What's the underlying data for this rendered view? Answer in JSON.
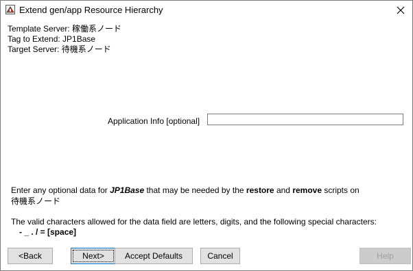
{
  "window": {
    "title": "Extend gen/app Resource Hierarchy",
    "icons": {
      "app": "app-icon",
      "close": "close-icon"
    }
  },
  "info": {
    "template_server": "Template Server: 稼働系ノード",
    "tag_to_extend": "Tag to Extend: JP1Base",
    "target_server": "Target Server: 待機系ノード"
  },
  "field": {
    "label": "Application Info [optional]",
    "value": ""
  },
  "description": {
    "part1": "Enter any optional data for ",
    "tag": "JP1Base",
    "part2": " that may be needed by the ",
    "restore": "restore",
    "part3": " and ",
    "remove": "remove",
    "part4": " scripts on",
    "server": "待機系ノード"
  },
  "valid_chars": {
    "text": "The valid characters allowed for the data field are letters, digits, and the following special characters:",
    "chars": "- _ . / = [space]"
  },
  "buttons": {
    "back": "<Back",
    "next": "Next>",
    "accept_defaults": "Accept Defaults",
    "cancel": "Cancel",
    "help": "Help"
  }
}
